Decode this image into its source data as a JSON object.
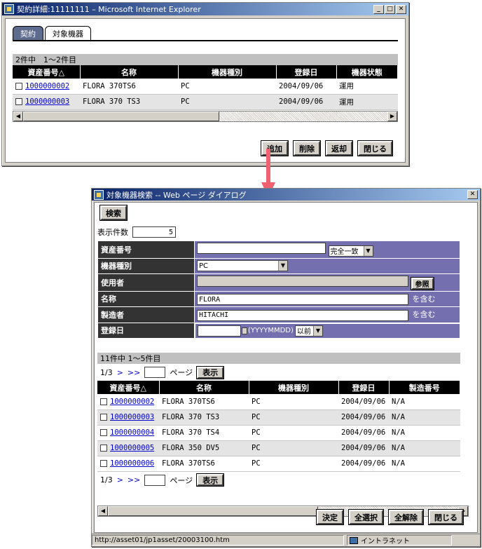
{
  "win1": {
    "title": "契約詳細:11111111 – Microsoft Internet Explorer",
    "tabs": [
      "契約",
      "対象機器"
    ],
    "count": "2件中　1～2件目",
    "columns": [
      "資産番号△",
      "名称",
      "機器種別",
      "登録日",
      "機器状態"
    ],
    "rows": [
      {
        "id": "1000000002",
        "name": "FLORA 370TS6",
        "type": "PC",
        "date": "2004/09/06",
        "status": "運用"
      },
      {
        "id": "1000000003",
        "name": "FLORA 370 TS3",
        "type": "PC",
        "date": "2004/09/06",
        "status": "運用"
      }
    ],
    "buttons": [
      "追加",
      "削除",
      "返却",
      "閉じる"
    ]
  },
  "win2": {
    "title": "対象機器検索 -- Web ページ ダイアログ",
    "search_btn": "検索",
    "display_count_label": "表示件数",
    "display_count_value": "5",
    "form": {
      "asset_no": "資産番号",
      "match_mode": "完全一致",
      "device_type": "機器種別",
      "device_type_value": "PC",
      "user": "使用者",
      "browse_btn": "参照",
      "name": "名称",
      "name_value": "FLORA",
      "contains": "を含む",
      "maker": "製造者",
      "maker_value": "HITACHI",
      "reg_date": "登録日",
      "date_fmt": "(YYYYMMDD)",
      "date_mode": "以前"
    },
    "count": "11件中 1～5件目",
    "pager": {
      "page": "1/3",
      "next": ">",
      "last": ">>",
      "page_label": "ページ",
      "show_btn": "表示"
    },
    "columns": [
      "資産番号△",
      "名称",
      "機器種別",
      "登録日",
      "製造番号"
    ],
    "rows": [
      {
        "id": "1000000002",
        "name": "FLORA 370TS6",
        "type": "PC",
        "date": "2004/09/06",
        "serial": "N/A"
      },
      {
        "id": "1000000003",
        "name": "FLORA 370 TS3",
        "type": "PC",
        "date": "2004/09/06",
        "serial": "N/A"
      },
      {
        "id": "1000000004",
        "name": "FLORA 370 TS4",
        "type": "PC",
        "date": "2004/09/06",
        "serial": "N/A"
      },
      {
        "id": "1000000005",
        "name": "FLORA 350 DV5",
        "type": "PC",
        "date": "2004/09/06",
        "serial": "N/A"
      },
      {
        "id": "1000000006",
        "name": "FLORA 370TS6",
        "type": "PC",
        "date": "2004/09/06",
        "serial": "N/A"
      }
    ],
    "buttons": [
      "決定",
      "全選択",
      "全解除",
      "閉じる"
    ],
    "status_url": "http://asset01/jp1asset/20003100.htm",
    "status_zone": "イントラネット"
  },
  "colors": {
    "arrow": "#f06070",
    "form_label_bg": "#333333",
    "form_value_bg": "#7470b0",
    "tab_inactive": "#5d6b8f"
  }
}
